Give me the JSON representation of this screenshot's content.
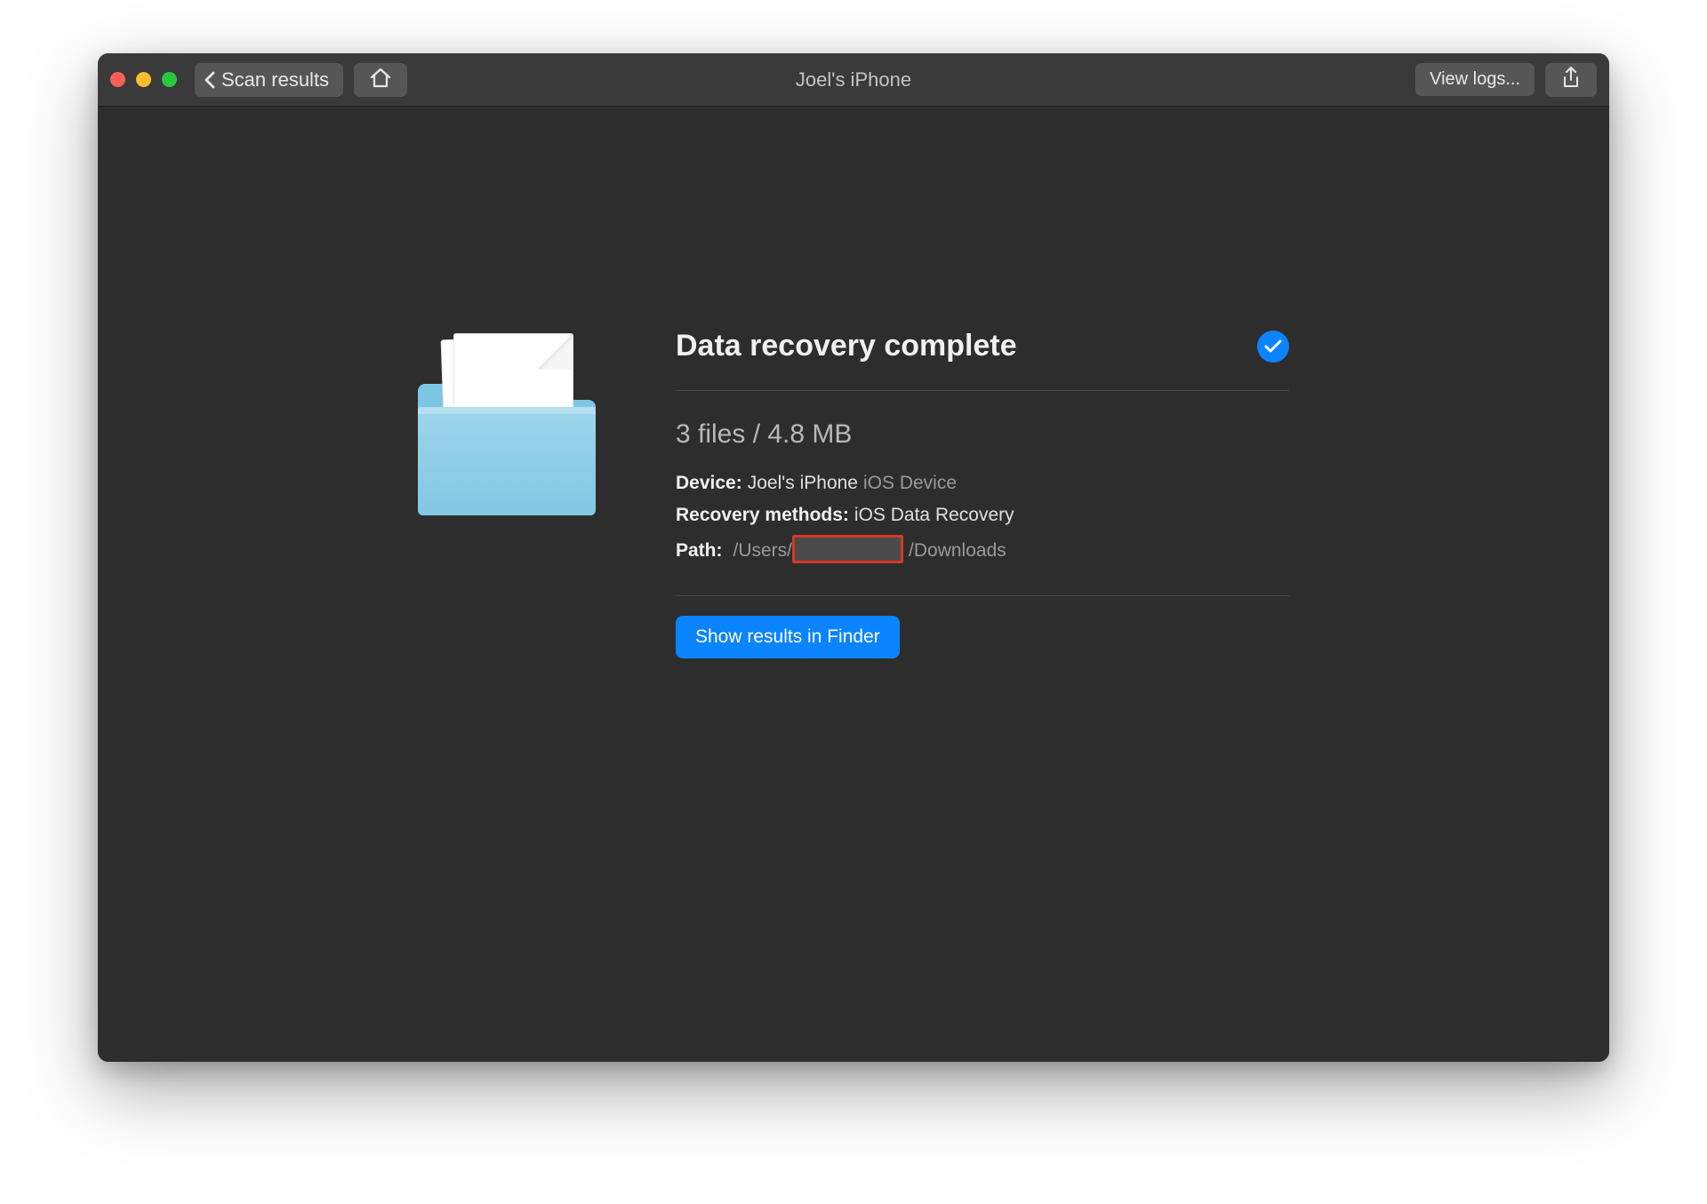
{
  "titlebar": {
    "back_label": "Scan results",
    "window_title": "Joel's iPhone",
    "view_logs_label": "View logs..."
  },
  "summary": {
    "heading": "Data recovery complete",
    "stats": "3 files / 4.8 MB",
    "device_label": "Device:",
    "device_value": "Joel's iPhone",
    "device_type": "iOS Device",
    "methods_label": "Recovery methods:",
    "methods_value": "iOS Data Recovery",
    "path_label": "Path:",
    "path_prefix": "/Users/",
    "path_suffix": "/Downloads",
    "show_finder_label": "Show results in Finder"
  },
  "colors": {
    "accent": "#0a84ff",
    "window_bg": "#2d2d2d",
    "toolbar_bg": "#3a3a3a"
  }
}
